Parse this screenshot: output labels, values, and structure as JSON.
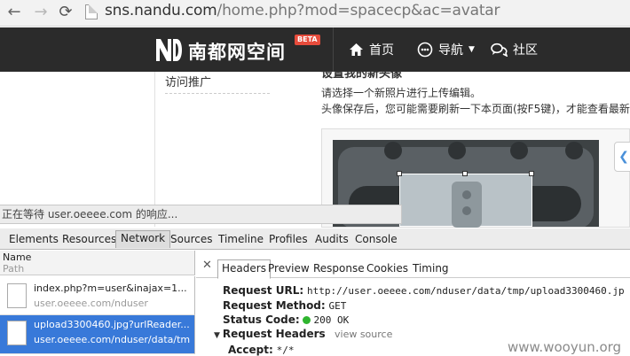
{
  "browser": {
    "url_host": "sns.nandu.com",
    "url_rest": "/home.php?mod=spacecp&ac=avatar"
  },
  "site": {
    "logo_text": "南都网空间",
    "beta": "BETA",
    "nav_home": "首页",
    "nav_guide": "导航",
    "nav_community": "社区"
  },
  "sidebar": {
    "link": "访问推广"
  },
  "content": {
    "title": "设置我的新头像",
    "line1": "请选择一个新照片进行上传编辑。",
    "line2": "头像保存后，您可能需要刷新一下本页面(按F5键)，才能查看最新"
  },
  "status_bubble": "正在等待 user.oeeee.com 的响应...",
  "devtools": {
    "tabs": [
      "Elements",
      "Resources",
      "Network",
      "Sources",
      "Timeline",
      "Profiles",
      "Audits",
      "Console"
    ],
    "active_tab": "Network",
    "list_header_name": "Name",
    "list_header_path": "Path",
    "requests": [
      {
        "name": "index.php?m=user&inajax=1...",
        "path": "user.oeeee.com/nduser"
      },
      {
        "name": "upload3300460.jpg?urlReader...",
        "path": "user.oeeee.com/nduser/data/tm"
      }
    ],
    "detail_tabs": [
      "Headers",
      "Preview",
      "Response",
      "Cookies",
      "Timing"
    ],
    "active_detail_tab": "Headers",
    "request_url_label": "Request URL:",
    "request_url": "http://user.oeeee.com/nduser/data/tmp/upload3300460.jp",
    "method_label": "Request Method:",
    "method": "GET",
    "status_label": "Status Code:",
    "status": "200 OK",
    "req_headers_label": "Request Headers",
    "view_source": "view source",
    "accept_label": "Accept:",
    "accept": "*/*"
  },
  "watermark": "www.wooyun.org",
  "colors": {
    "navbar": "#2b2b2b",
    "beta": "#e74c3c",
    "selected_row": "#3879d9",
    "status_ok": "#2fb52f"
  },
  "icons": {
    "back": "back-arrow-icon",
    "forward": "forward-arrow-icon",
    "reload": "reload-icon",
    "home": "home-icon",
    "guide": "compass-icon",
    "community": "chat-icon"
  }
}
